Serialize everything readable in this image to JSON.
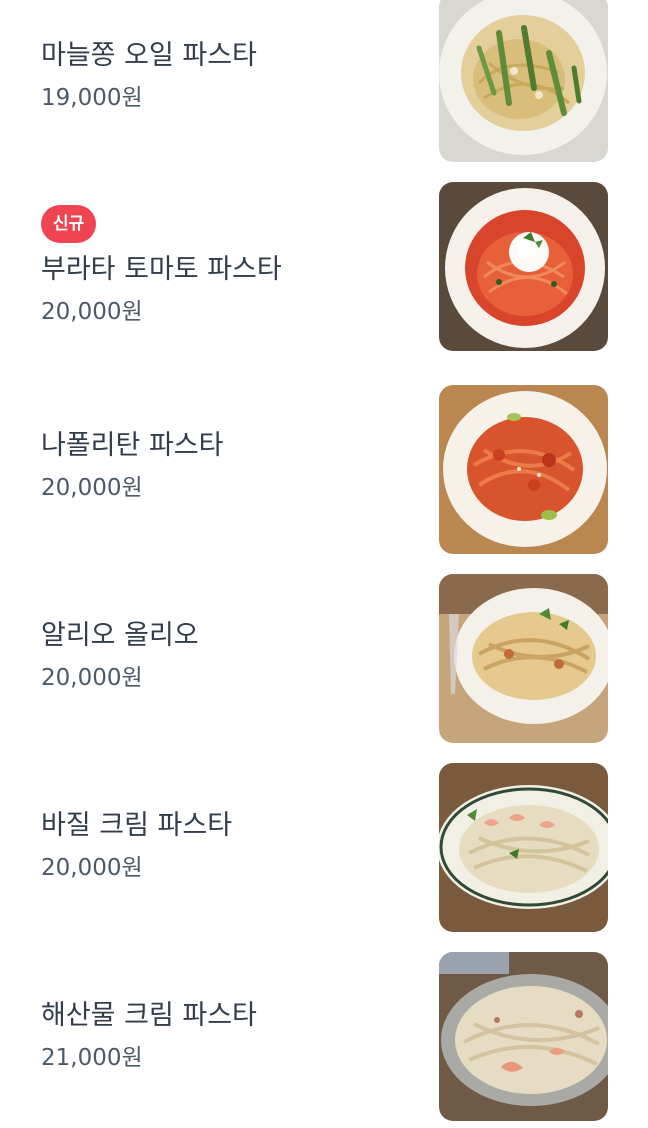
{
  "menu": {
    "items": [
      {
        "name": "마늘쫑 오일 파스타",
        "price": "19,000원",
        "badge": ""
      },
      {
        "name": "부라타 토마토 파스타",
        "price": "20,000원",
        "badge": "신규"
      },
      {
        "name": "나폴리탄 파스타",
        "price": "20,000원",
        "badge": ""
      },
      {
        "name": "알리오 올리오",
        "price": "20,000원",
        "badge": ""
      },
      {
        "name": "바질 크림 파스타",
        "price": "20,000원",
        "badge": ""
      },
      {
        "name": "해산물 크림 파스타",
        "price": "21,000원",
        "badge": ""
      }
    ]
  },
  "colors": {
    "badge": "#f04452",
    "name_text": "#333d4b",
    "price_text": "#4e5968"
  }
}
